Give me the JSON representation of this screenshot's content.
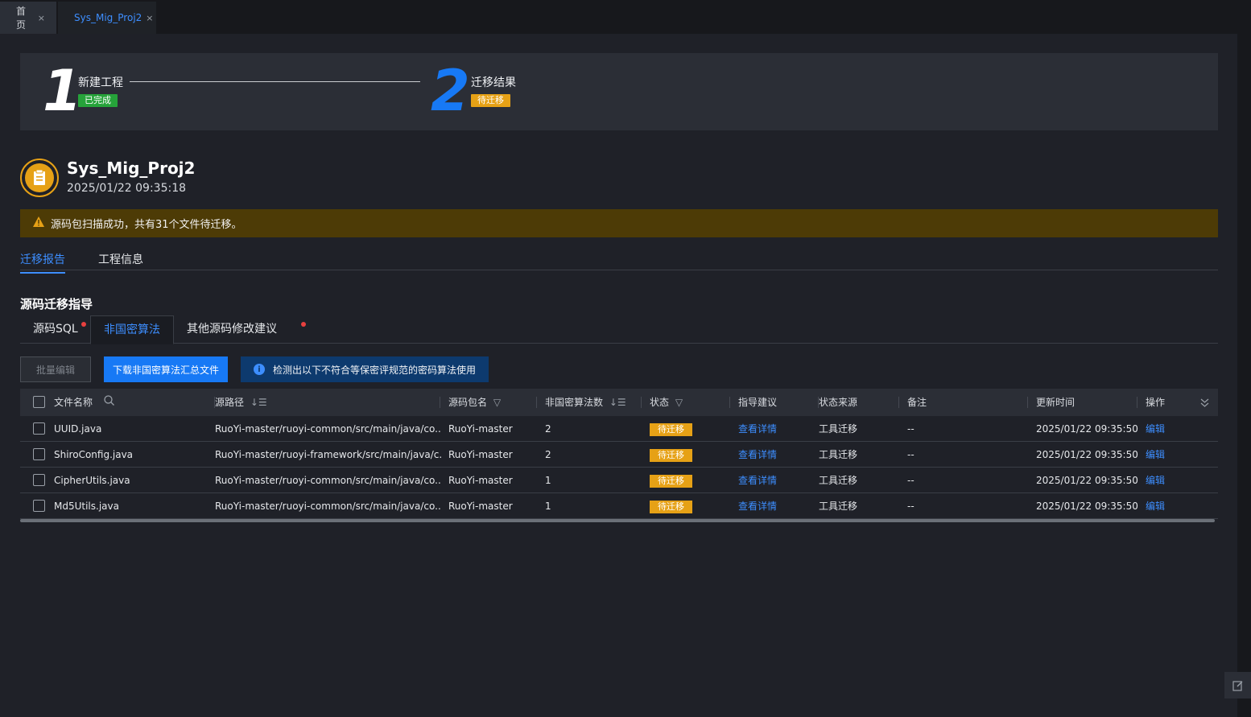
{
  "top_tabs": [
    {
      "label": "首页",
      "close": "×"
    },
    {
      "label": "Sys_Mig_Proj2",
      "close": "×"
    }
  ],
  "stepper": {
    "steps": [
      {
        "number": "1",
        "title": "新建工程",
        "status": "已完成"
      },
      {
        "number": "2",
        "title": "迁移结果",
        "status": "待迁移"
      }
    ]
  },
  "project": {
    "name": "Sys_Mig_Proj2",
    "time": "2025/01/22 09:35:18"
  },
  "alert": {
    "text": "源码包扫描成功，共有31个文件待迁移。"
  },
  "main_tabs": [
    "迁移报告",
    "工程信息"
  ],
  "section_title": "源码迁移指导",
  "sub_tabs": [
    "源码SQL",
    "非国密算法",
    "其他源码修改建议"
  ],
  "toolbar": {
    "batch_edit": "批量编辑",
    "download": "下载非国密算法汇总文件",
    "info": "检测出以下不符合等保密评规范的密码算法使用",
    "info_icon": "i"
  },
  "table": {
    "headers": {
      "filename": "文件名称",
      "path": "源路径",
      "package": "源码包名",
      "count": "非国密算法数",
      "status": "状态",
      "advice": "指导建议",
      "source": "状态来源",
      "remark": "备注",
      "updated": "更新时间",
      "action": "操作"
    },
    "rows": [
      {
        "filename": "UUID.java",
        "path": "RuoYi-master/ruoyi-common/src/main/java/co...",
        "package": "RuoYi-master",
        "count": "2",
        "status": "待迁移",
        "advice": "查看详情",
        "source": "工具迁移",
        "remark": "--",
        "updated": "2025/01/22 09:35:50",
        "action": "编辑"
      },
      {
        "filename": "ShiroConfig.java",
        "path": "RuoYi-master/ruoyi-framework/src/main/java/c...",
        "package": "RuoYi-master",
        "count": "2",
        "status": "待迁移",
        "advice": "查看详情",
        "source": "工具迁移",
        "remark": "--",
        "updated": "2025/01/22 09:35:50",
        "action": "编辑"
      },
      {
        "filename": "CipherUtils.java",
        "path": "RuoYi-master/ruoyi-common/src/main/java/co...",
        "package": "RuoYi-master",
        "count": "1",
        "status": "待迁移",
        "advice": "查看详情",
        "source": "工具迁移",
        "remark": "--",
        "updated": "2025/01/22 09:35:50",
        "action": "编辑"
      },
      {
        "filename": "Md5Utils.java",
        "path": "RuoYi-master/ruoyi-common/src/main/java/co...",
        "package": "RuoYi-master",
        "count": "1",
        "status": "待迁移",
        "advice": "查看详情",
        "source": "工具迁移",
        "remark": "--",
        "updated": "2025/01/22 09:35:50",
        "action": "编辑"
      }
    ]
  },
  "colors": {
    "accent": "#1779f5",
    "success": "#26a33a",
    "warning": "#e6a116",
    "background": "#1f2128"
  }
}
